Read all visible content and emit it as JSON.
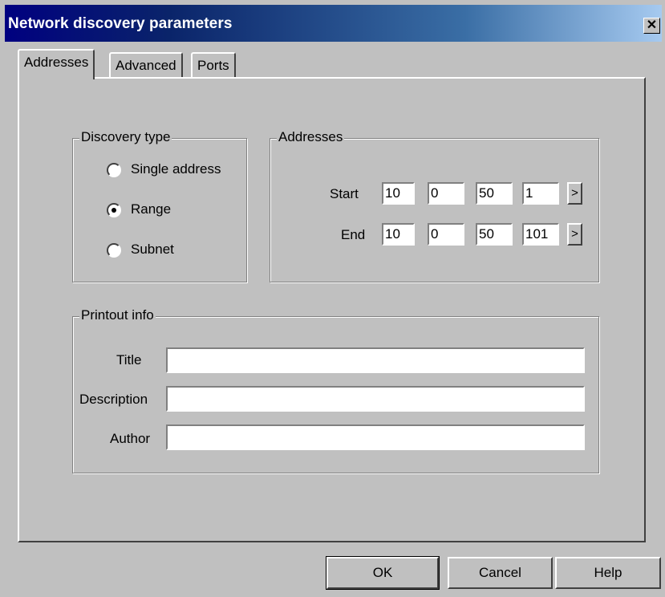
{
  "window": {
    "title": "Network discovery parameters",
    "close_glyph": "✕"
  },
  "tabs": [
    {
      "label": "Addresses",
      "active": true
    },
    {
      "label": "Advanced",
      "active": false
    },
    {
      "label": "Ports",
      "active": false
    }
  ],
  "discovery_type": {
    "label": "Discovery type",
    "options": [
      {
        "label": "Single address",
        "checked": false
      },
      {
        "label": "Range",
        "checked": true
      },
      {
        "label": "Subnet",
        "checked": false
      }
    ]
  },
  "addresses": {
    "label": "Addresses",
    "start_label": "Start",
    "end_label": "End",
    "start": [
      "10",
      "0",
      "50",
      "1"
    ],
    "end": [
      "10",
      "0",
      "50",
      "101"
    ],
    "arrow_glyph": ">"
  },
  "printout": {
    "label": "Printout info",
    "title_label": "Title",
    "description_label": "Description",
    "author_label": "Author",
    "title_value": "",
    "description_value": "",
    "author_value": ""
  },
  "buttons": {
    "ok": "OK",
    "cancel": "Cancel",
    "help": "Help"
  },
  "colors": {
    "face": "#c0c0c0",
    "title_start": "#000080",
    "title_end": "#a6caf0"
  }
}
